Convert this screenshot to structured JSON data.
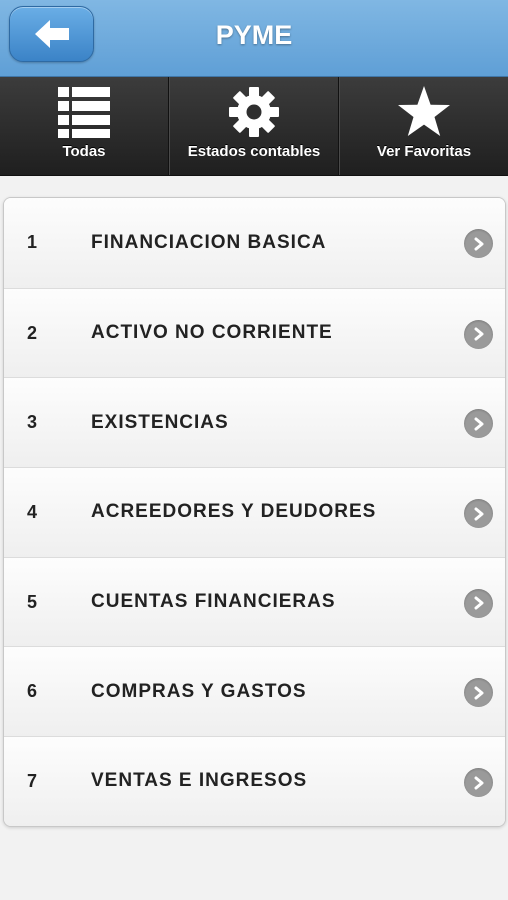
{
  "header": {
    "title": "PYME",
    "back_icon": "arrow-left-icon"
  },
  "navbar": {
    "items": [
      {
        "label": "Todas",
        "icon": "list-icon"
      },
      {
        "label": "Estados contables",
        "icon": "gear-icon"
      },
      {
        "label": "Ver Favoritas",
        "icon": "star-icon"
      }
    ]
  },
  "list": {
    "items": [
      {
        "number": "1",
        "label": "FINANCIACION BASICA"
      },
      {
        "number": "2",
        "label": "ACTIVO NO CORRIENTE"
      },
      {
        "number": "3",
        "label": "EXISTENCIAS"
      },
      {
        "number": "4",
        "label": "ACREEDORES Y DEUDORES"
      },
      {
        "number": "5",
        "label": "CUENTAS FINANCIERAS"
      },
      {
        "number": "6",
        "label": "COMPRAS Y GASTOS"
      },
      {
        "number": "7",
        "label": "VENTAS E INGRESOS"
      }
    ]
  },
  "colors": {
    "header": "#6fa9dc",
    "navbar": "#2b2b2b",
    "chevron": "#9a9a9a"
  }
}
